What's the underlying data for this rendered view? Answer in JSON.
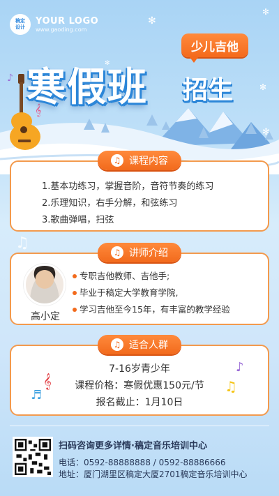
{
  "logo": {
    "badge": "稿定\n设计",
    "name": "YOUR LOGO",
    "url": "www.gaoding.com"
  },
  "tag": "少儿吉他",
  "title": {
    "main": "寒假班",
    "sub": "招生"
  },
  "sections": {
    "course": {
      "heading": "课程内容",
      "items": [
        "1.基本功练习，掌握音阶，音符节奏的练习",
        "2.乐理知识，右手分解，和弦练习",
        "3.歌曲弹唱，扫弦"
      ]
    },
    "teacher": {
      "heading": "讲师介绍",
      "name": "高小定",
      "items": [
        "专职吉他教师、吉他手;",
        "毕业于稿定大学教育学院,",
        "学习吉他至今15年，有丰富的教学经验"
      ]
    },
    "audience": {
      "heading": "适合人群",
      "lines": [
        "7-16岁青少年",
        "课程价格：寒假优惠150元/节",
        "报名截止：1月10日"
      ]
    }
  },
  "footer": {
    "headline": "扫码咨询更多详情·稿定音乐培训中心",
    "phone": "电话：0592-88888888 / 0592-88886666",
    "address": "地址：厦门湖里区稿定大厦2701稿定音乐培训中心"
  },
  "colors": {
    "accent": "#f26a1c",
    "title_shadow": "#2c86d8",
    "background": "#bfe0f8"
  }
}
